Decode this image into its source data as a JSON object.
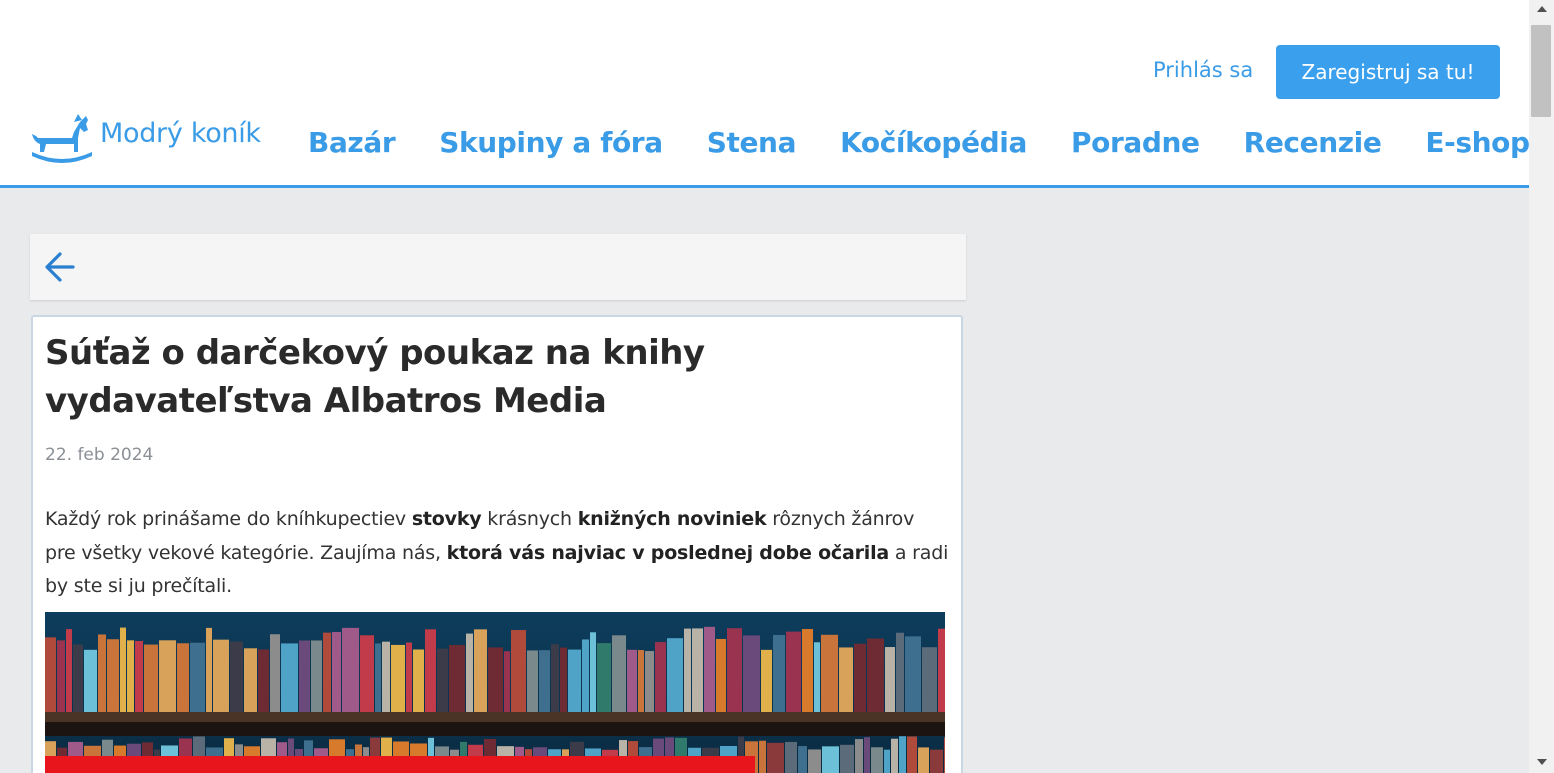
{
  "header": {
    "login_label": "Prihlás sa",
    "register_label": "Zaregistruj sa tu!",
    "logo_text": "Modrý koník",
    "logo_icon": "rocking-horse-icon",
    "nav": [
      {
        "label": "Bazár"
      },
      {
        "label": "Skupiny a fóra"
      },
      {
        "label": "Stena"
      },
      {
        "label": "Kočíkopédia"
      },
      {
        "label": "Poradne"
      },
      {
        "label": "Recenzie"
      },
      {
        "label": "E-shop"
      }
    ]
  },
  "back": {
    "icon": "arrow-left-icon"
  },
  "article": {
    "title": "Súťaž o darčekový poukaz na knihy vydavateľstva Albatros Media",
    "date": "22. feb 2024",
    "paragraph": [
      {
        "text": "Každý rok prinášame do kníhkupectiev ",
        "bold": false
      },
      {
        "text": "stovky",
        "bold": true
      },
      {
        "text": " krásnych ",
        "bold": false
      },
      {
        "text": "knižných noviniek",
        "bold": true
      },
      {
        "text": " rôznych žánrov pre všetky vekové kategórie. Zaujíma nás, ",
        "bold": false
      },
      {
        "text": "ktorá vás najviac v poslednej dobe očarila",
        "bold": true
      },
      {
        "text": " a radi by ste si ju prečítali.",
        "bold": false
      }
    ],
    "image": "bookshelf-image"
  },
  "colors": {
    "accent": "#3a9be6",
    "button": "#3aa0ee",
    "page_bg": "#e9eaec",
    "card_border": "#c9d7e4"
  }
}
